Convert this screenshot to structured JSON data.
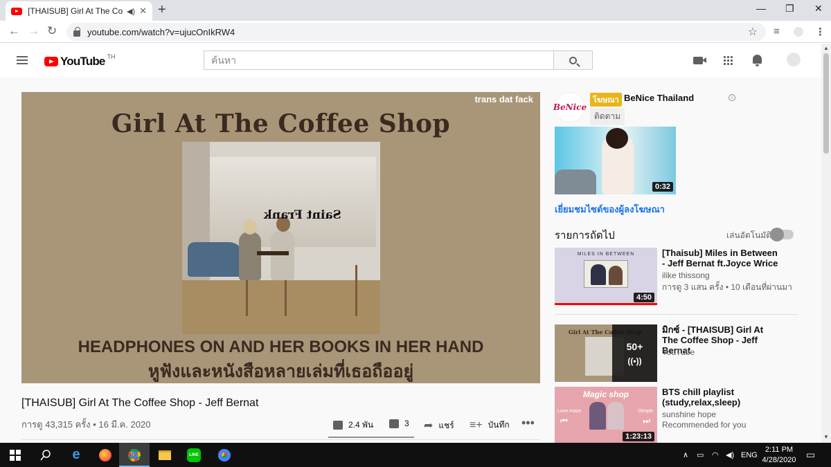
{
  "browser": {
    "tab_title": "[THAISUB] Girl At The Coffee",
    "url": "youtube.com/watch?v=ujucOnIkRW4"
  },
  "masthead": {
    "logo_text": "YouTube",
    "region": "TH",
    "search_placeholder": "ค้นหา"
  },
  "player": {
    "credit": "trans dat fack",
    "title_art": "Girl At The Coffee Shop",
    "sign_text": "Saint Frank",
    "caption_en": "HEADPHONES ON AND HER BOOKS IN HER HAND",
    "caption_th": "หูฟังและหนังสือหลายเล่มที่เธอถืออยู่"
  },
  "video": {
    "title": "[THAISUB] Girl At The Coffee Shop - Jeff Bernat",
    "views": "การดู 43,315 ครั้ง • 16 มี.ค. 2020",
    "likes": "2.4 พัน",
    "dislikes": "3",
    "share": "แชร์",
    "save": "บันทึก",
    "like_ratio": 0.999
  },
  "ad": {
    "logo_text": "BeNice",
    "badge": "โฆษณา",
    "name": "BeNice Thailand",
    "follow": "ติดตาม",
    "duration": "0:32",
    "link": "เยี่ยมชมไซต์ของผู้ลงโฆษณา"
  },
  "sidebar": {
    "up_next": "รายการถัดไป",
    "autoplay": "เล่นอัตโนมัติ",
    "recs": [
      {
        "title": "[Thaisub] Miles in Between - Jeff Bernat ft.Joyce Wrice",
        "channel": "ilike thissong",
        "meta": "การดู 3 แสน ครั้ง • 10 เดือนที่ผ่านมา",
        "duration": "4:50",
        "thumb_text": "MILES IN BETWEEN",
        "watched": 1.0
      },
      {
        "title": "มิกซ์ - [THAISUB] Girl At The Coffee Shop - Jeff Bernat",
        "channel": "YouTube",
        "count": "50+",
        "thumb_text": "Girl At The Coffee Shop"
      },
      {
        "title": "BTS chill playlist (study,relax,sleep)",
        "channel": "sunshine hope",
        "meta": "Recommended for you",
        "duration": "1:23:13",
        "thumb_text": "Magic shop",
        "thumb_left": "Love maze",
        "thumb_right": "Dimple"
      }
    ]
  },
  "taskbar": {
    "lang": "ENG",
    "time": "2:11 PM",
    "date": "4/28/2020"
  }
}
